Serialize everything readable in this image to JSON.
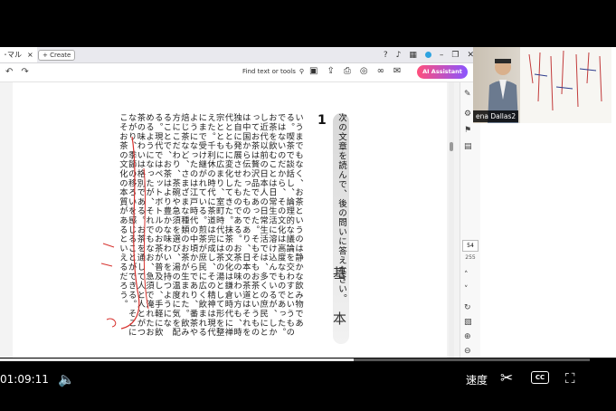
{
  "acrobat": {
    "tab_label": "･マル",
    "tab_close": "×",
    "create_label": "+ Create",
    "find_label": "Find text or tools",
    "ai_label": "AI Assistant",
    "page_current": "54",
    "page_total": "255"
  },
  "document": {
    "question_number": "1",
    "instruction": "次の文章を読んで、後の問いに答えなさい。",
    "side_label_1": "基",
    "side_label_2": "本",
    "body_text": "いうまでもなく、お茶というのは静かな飲み物である。喫茶で談話し、論理的な議論を交わすというものではないのだから、その文化は高度なものであった。お茶を飲むことは日常生活に溶け込んでいるが、しかし近代以前の日本人の日常生活では、多くの庶民にとってお茶は贅沢品であった。そもそもお茶というものは中国から伝わったものであり、日本の茶道はそれを独自に発展させたものである。お茶の味わい方も、時代とともに変化してきた。抹茶の文化は鎌倉時代に禅宗とともに広まり、室町時代には茶の湯として形を整えた。千利休の時代に茶道は完成し、その精神は現代にまで受け継がれている。煎茶が庶民に広く飲まれるようになったのは江戸時代の中頃からであり、番茶や焙じ茶など、さまざまな種類のお茶が生まれた。飲み方にこだわり、茶碗や急須を選び、湯の温度に気を配ることで、お茶はより豊かな味わいを持つようになる。現代ではペットボトルのお茶が普及し、手軽に飲めるようになったが、それでもなお、急須で淹れたお茶の味わいは格別である。お茶を通して人と人とがつながり、季節の移ろいを感じることができる。そこにこそお茶の文化の本質があるといえるだろう。"
  },
  "webcam": {
    "name_label": "ena Dallas2"
  },
  "player": {
    "time": "01:09:11",
    "speed_label": "速度",
    "cc_label": "CC",
    "progress": 0.6
  }
}
